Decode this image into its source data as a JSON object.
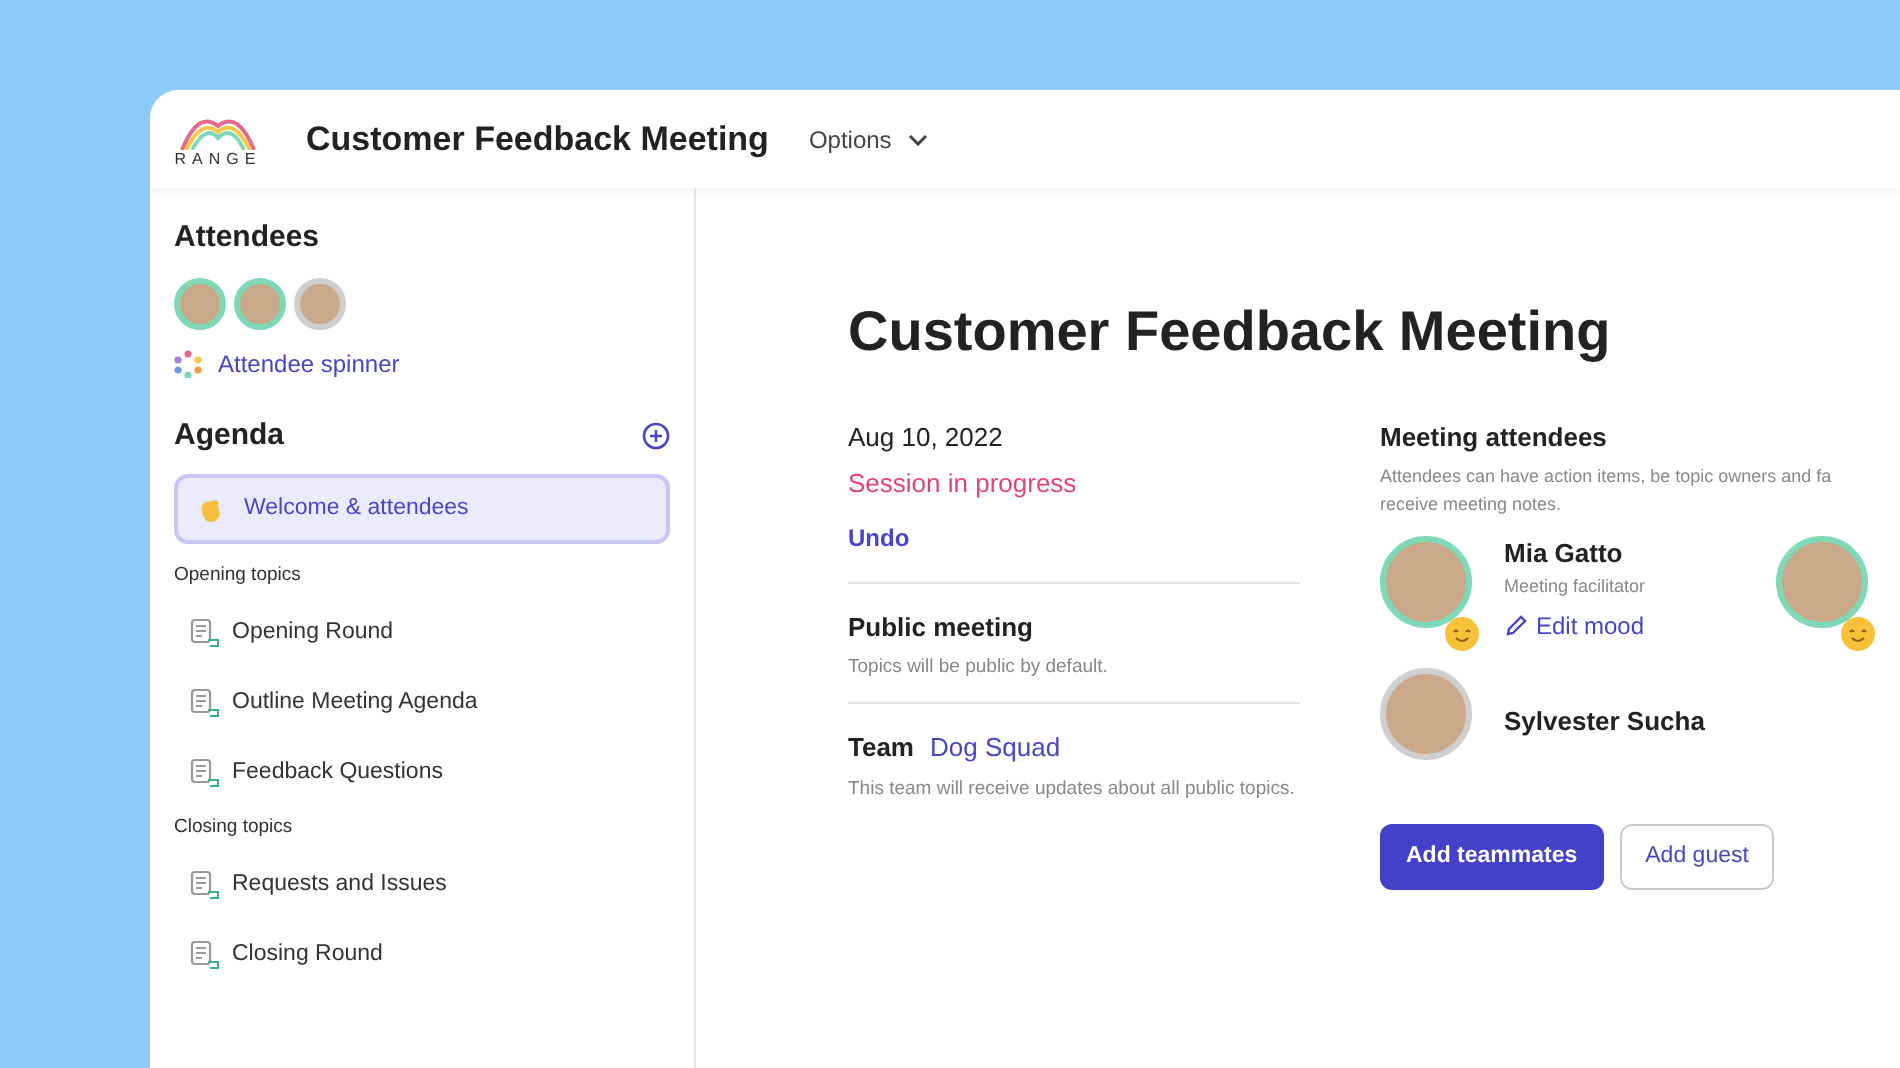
{
  "header": {
    "logo_text": "RANGE",
    "title": "Customer Feedback Meeting",
    "options": "Options"
  },
  "sidebar": {
    "attendees_title": "Attendees",
    "attendees": [
      {
        "present": true
      },
      {
        "present": true
      },
      {
        "present": false
      }
    ],
    "spinner": "Attendee spinner",
    "agenda_title": "Agenda",
    "agenda": [
      {
        "kind": "item",
        "label": "Welcome & attendees",
        "selected": true
      },
      {
        "kind": "section",
        "label": "Opening topics"
      },
      {
        "kind": "topic",
        "label": "Opening Round",
        "selected": false
      },
      {
        "kind": "topic",
        "label": "Outline Meeting Agenda",
        "selected": false
      },
      {
        "kind": "topic",
        "label": "Feedback Questions",
        "selected": false
      },
      {
        "kind": "section",
        "label": "Closing topics"
      },
      {
        "kind": "topic",
        "label": "Requests and Issues",
        "selected": false
      },
      {
        "kind": "topic",
        "label": "Closing Round",
        "selected": false
      }
    ]
  },
  "main": {
    "title": "Customer Feedback Meeting",
    "date": "Aug 10, 2022",
    "status": "Session in progress",
    "undo": "Undo",
    "public": {
      "title": "Public meeting",
      "note": "Topics will be public by default."
    },
    "team": {
      "label": "Team",
      "name": "Dog Squad",
      "note": "This team will receive updates about all public topics."
    },
    "attendees_title": "Meeting attendees",
    "attendees_note": [
      "Attendees can have action items, be topic owners and fa",
      "receive meeting notes."
    ],
    "people": [
      {
        "name": "Mia Gatto",
        "role": "Meeting facilitator",
        "action": "Edit mood",
        "present": true,
        "mood": true
      },
      {
        "present": true,
        "mood": true
      },
      {
        "name": "Sylvester Sucha",
        "present": false,
        "mood": false
      }
    ],
    "buttons": [
      {
        "label": "Add teammates",
        "kind": "primary"
      },
      {
        "label": "Add guest",
        "kind": "outline"
      }
    ]
  }
}
